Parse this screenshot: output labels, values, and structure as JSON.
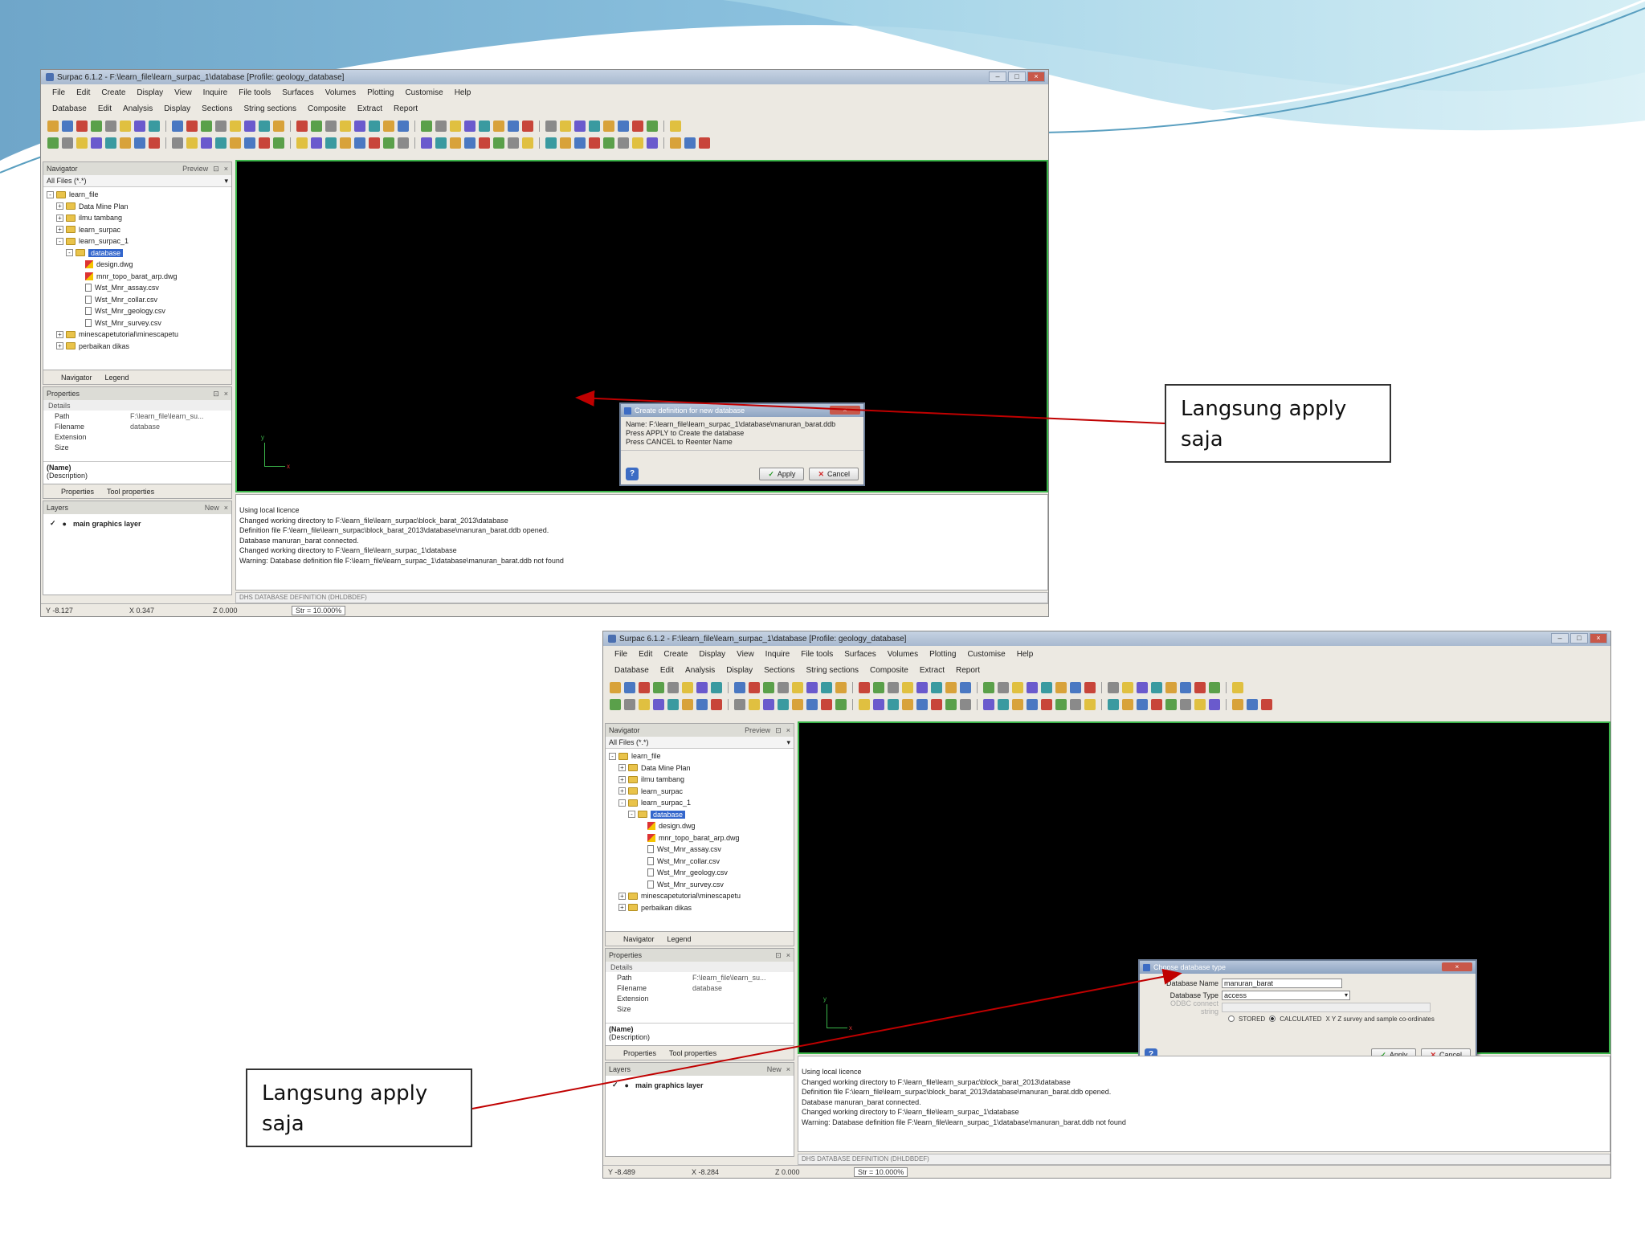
{
  "screen1": {
    "title": "Surpac 6.1.2 - F:\\learn_file\\learn_surpac_1\\database [Profile: geology_database]",
    "menu_row1": [
      "File",
      "Edit",
      "Create",
      "Display",
      "View",
      "Inquire",
      "File tools",
      "Surfaces",
      "Volumes",
      "Plotting",
      "Customise",
      "Help"
    ],
    "menu_row2": [
      "Database",
      "Edit",
      "Analysis",
      "Display",
      "Sections",
      "String sections",
      "Composite",
      "Extract",
      "Report"
    ],
    "navigator": {
      "title": "Navigator",
      "preview": "Preview",
      "filter": "All Files (*.*)",
      "tree": [
        {
          "label": "learn_file",
          "kind": "folder",
          "indent": 0,
          "exp": "-"
        },
        {
          "label": "Data Mine Plan",
          "kind": "folder",
          "indent": 1,
          "exp": "+"
        },
        {
          "label": "ilmu tambang",
          "kind": "folder",
          "indent": 1,
          "exp": "+"
        },
        {
          "label": "learn_surpac",
          "kind": "folder",
          "indent": 1,
          "exp": "+"
        },
        {
          "label": "learn_surpac_1",
          "kind": "folder",
          "indent": 1,
          "exp": "-"
        },
        {
          "label": "database",
          "kind": "folder",
          "indent": 2,
          "exp": "-",
          "selected": true
        },
        {
          "label": "design.dwg",
          "kind": "dwg",
          "indent": 3
        },
        {
          "label": "mnr_topo_barat_arp.dwg",
          "kind": "dwg",
          "indent": 3
        },
        {
          "label": "Wst_Mnr_assay.csv",
          "kind": "file",
          "indent": 3
        },
        {
          "label": "Wst_Mnr_collar.csv",
          "kind": "file",
          "indent": 3
        },
        {
          "label": "Wst_Mnr_geology.csv",
          "kind": "file",
          "indent": 3
        },
        {
          "label": "Wst_Mnr_survey.csv",
          "kind": "file",
          "indent": 3
        },
        {
          "label": "minescapetutorial\\minescapetu",
          "kind": "folder",
          "indent": 1,
          "exp": "+"
        },
        {
          "label": "perbaikan dikas",
          "kind": "folder",
          "indent": 1,
          "exp": "+"
        }
      ],
      "tab_navigator": "Navigator",
      "tab_legend": "Legend"
    },
    "properties": {
      "title": "Properties",
      "group": "Details",
      "rows": [
        {
          "k": "Path",
          "v": "F:\\learn_file\\learn_su..."
        },
        {
          "k": "Filename",
          "v": "database"
        },
        {
          "k": "Extension",
          "v": ""
        },
        {
          "k": "Size",
          "v": ""
        }
      ],
      "name_label": "(Name)",
      "desc_label": "(Description)",
      "tab_properties": "Properties",
      "tab_tool": "Tool properties"
    },
    "layers": {
      "title": "Layers",
      "new": "New",
      "row": "main graphics layer"
    },
    "dialog": {
      "title": "Create definition for new database",
      "lines": [
        "Name: F:\\learn_file\\learn_surpac_1\\database\\manuran_barat.ddb",
        "Press APPLY to Create the database",
        "Press CANCEL to Reenter Name"
      ],
      "apply": "Apply",
      "cancel": "Cancel"
    },
    "messages": [
      "Using local licence",
      "Changed working directory to F:\\learn_file\\learn_surpac\\block_barat_2013\\database",
      "Definition file F:\\learn_file\\learn_surpac\\block_barat_2013\\database\\manuran_barat.ddb opened.",
      "Database manuran_barat connected.",
      "Changed working directory to F:\\learn_file\\learn_surpac_1\\database",
      "Warning: Database definition file F:\\learn_file\\learn_surpac_1\\database\\manuran_barat.ddb not found"
    ],
    "command": "DHS DATABASE DEFINITION (DHLDBDEF)",
    "status": {
      "y": "Y -8.127",
      "x": "X 0.347",
      "z": "Z 0.000",
      "scale": "Str = 10.000%"
    }
  },
  "screen2": {
    "title": "Surpac 6.1.2 - F:\\learn_file\\learn_surpac_1\\database [Profile: geology_database]",
    "menu_row1": [
      "File",
      "Edit",
      "Create",
      "Display",
      "View",
      "Inquire",
      "File tools",
      "Surfaces",
      "Volumes",
      "Plotting",
      "Customise",
      "Help"
    ],
    "menu_row2": [
      "Database",
      "Edit",
      "Analysis",
      "Display",
      "Sections",
      "String sections",
      "Composite",
      "Extract",
      "Report"
    ],
    "navigator": {
      "title": "Navigator",
      "preview": "Preview",
      "filter": "All Files (*.*)",
      "tree": [
        {
          "label": "learn_file",
          "kind": "folder",
          "indent": 0,
          "exp": "-"
        },
        {
          "label": "Data Mine Plan",
          "kind": "folder",
          "indent": 1,
          "exp": "+"
        },
        {
          "label": "ilmu tambang",
          "kind": "folder",
          "indent": 1,
          "exp": "+"
        },
        {
          "label": "learn_surpac",
          "kind": "folder",
          "indent": 1,
          "exp": "+"
        },
        {
          "label": "learn_surpac_1",
          "kind": "folder",
          "indent": 1,
          "exp": "-"
        },
        {
          "label": "database",
          "kind": "folder",
          "indent": 2,
          "exp": "-",
          "selected": true
        },
        {
          "label": "design.dwg",
          "kind": "dwg",
          "indent": 3
        },
        {
          "label": "mnr_topo_barat_arp.dwg",
          "kind": "dwg",
          "indent": 3
        },
        {
          "label": "Wst_Mnr_assay.csv",
          "kind": "file",
          "indent": 3
        },
        {
          "label": "Wst_Mnr_collar.csv",
          "kind": "file",
          "indent": 3
        },
        {
          "label": "Wst_Mnr_geology.csv",
          "kind": "file",
          "indent": 3
        },
        {
          "label": "Wst_Mnr_survey.csv",
          "kind": "file",
          "indent": 3
        },
        {
          "label": "minescapetutorial\\minescapetu",
          "kind": "folder",
          "indent": 1,
          "exp": "+"
        },
        {
          "label": "perbaikan dikas",
          "kind": "folder",
          "indent": 1,
          "exp": "+"
        }
      ],
      "tab_navigator": "Navigator",
      "tab_legend": "Legend"
    },
    "properties": {
      "title": "Properties",
      "group": "Details",
      "rows": [
        {
          "k": "Path",
          "v": "F:\\learn_file\\learn_su..."
        },
        {
          "k": "Filename",
          "v": "database"
        },
        {
          "k": "Extension",
          "v": ""
        },
        {
          "k": "Size",
          "v": ""
        }
      ],
      "name_label": "(Name)",
      "desc_label": "(Description)",
      "tab_properties": "Properties",
      "tab_tool": "Tool properties"
    },
    "layers": {
      "title": "Layers",
      "new": "New",
      "row": "main graphics layer"
    },
    "dialog": {
      "title": "Choose database type",
      "name_label": "Database Name",
      "name_value": "manuran_barat",
      "type_label": "Database Type",
      "type_value": "access",
      "odbc_label": "ODBC connect string",
      "radio_stored": "STORED",
      "radio_calculated": "CALCULATED",
      "radio_note": "X Y Z survey and sample co-ordinates",
      "apply": "Apply",
      "cancel": "Cancel"
    },
    "messages": [
      "Using local licence",
      "Changed working directory to F:\\learn_file\\learn_surpac\\block_barat_2013\\database",
      "Definition file F:\\learn_file\\learn_surpac\\block_barat_2013\\database\\manuran_barat.ddb opened.",
      "Database manuran_barat connected.",
      "Changed working directory to F:\\learn_file\\learn_surpac_1\\database",
      "Warning: Database definition file F:\\learn_file\\learn_surpac_1\\database\\manuran_barat.ddb not found"
    ],
    "command": "DHS DATABASE DEFINITION (DHLDBDEF)",
    "status": {
      "y": "Y -8.489",
      "x": "X -8.284",
      "z": "Z 0.000",
      "scale": "Str = 10.000%"
    }
  },
  "callout1": {
    "line1": "Langsung apply",
    "line2": "saja"
  },
  "callout2": {
    "line1": "Langsung apply",
    "line2": "saja"
  },
  "colors": {
    "arrow": "#c00000",
    "viewport": "#000000",
    "viewport_border": "#3bb54a",
    "selection": "#3366cc"
  }
}
